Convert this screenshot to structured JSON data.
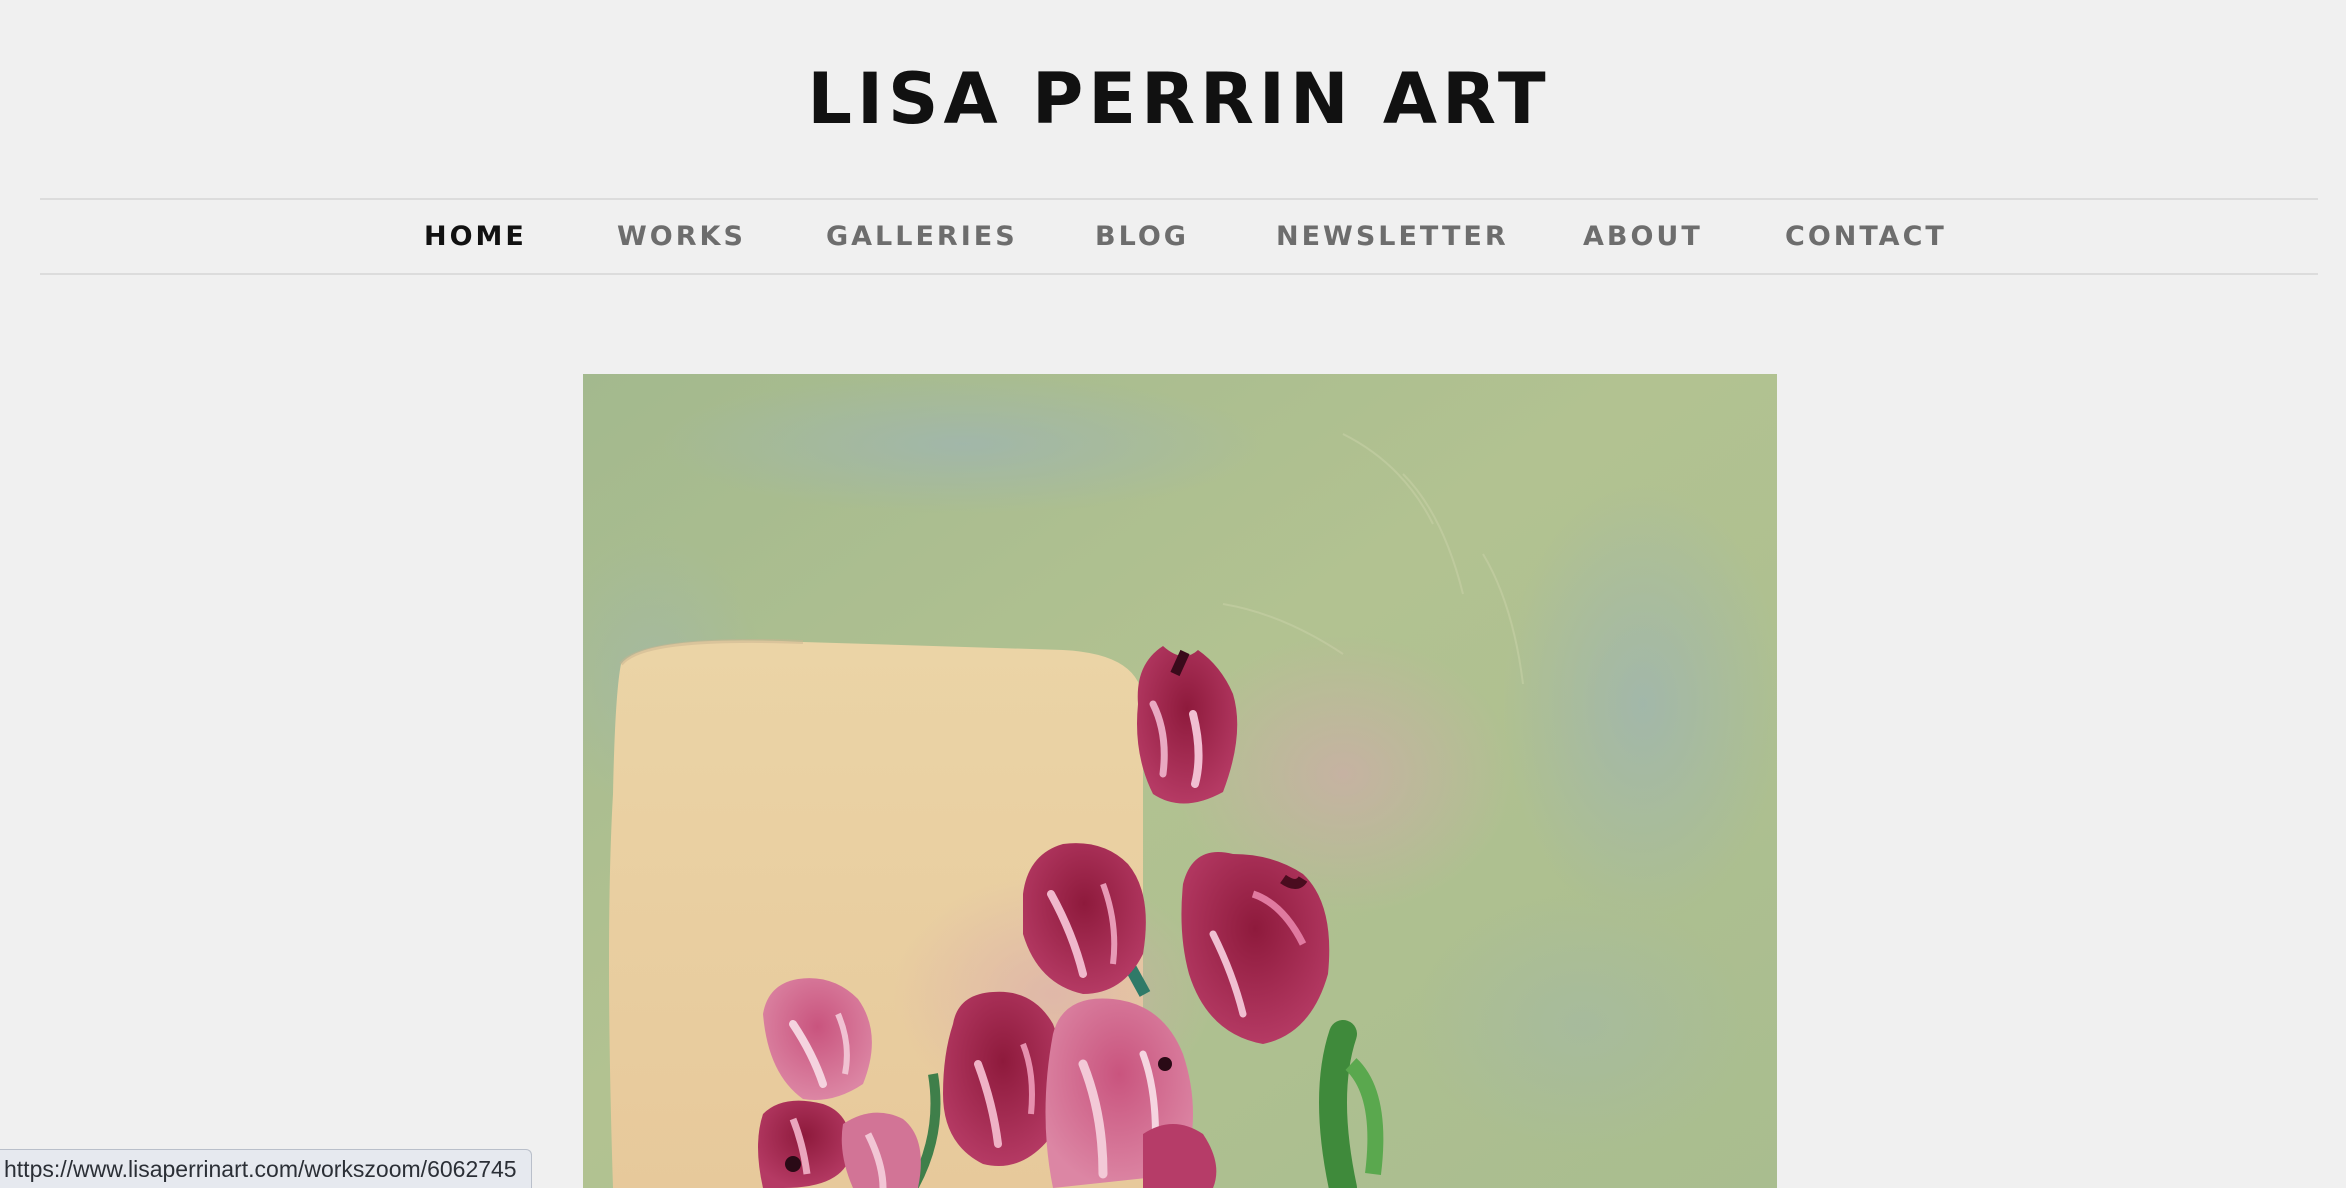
{
  "site": {
    "title": "LISA PERRIN ART"
  },
  "nav": {
    "items": [
      {
        "label": "HOME",
        "active": true
      },
      {
        "label": "WORKS"
      },
      {
        "label": "GALLERIES"
      },
      {
        "label": "BLOG"
      },
      {
        "label": "NEWSLETTER"
      },
      {
        "label": "ABOUT"
      },
      {
        "label": "CONTACT"
      }
    ]
  },
  "main": {
    "artwork": {
      "subject": "painting of pink tulips on a green background"
    }
  },
  "browser": {
    "status_url": "https://www.lisaperrinart.com/workszoom/6062745"
  },
  "colors": {
    "background": "#f0f0f0",
    "text_active": "#111111",
    "text_nav": "#6d6d6d",
    "divider": "#dcdcdc"
  }
}
